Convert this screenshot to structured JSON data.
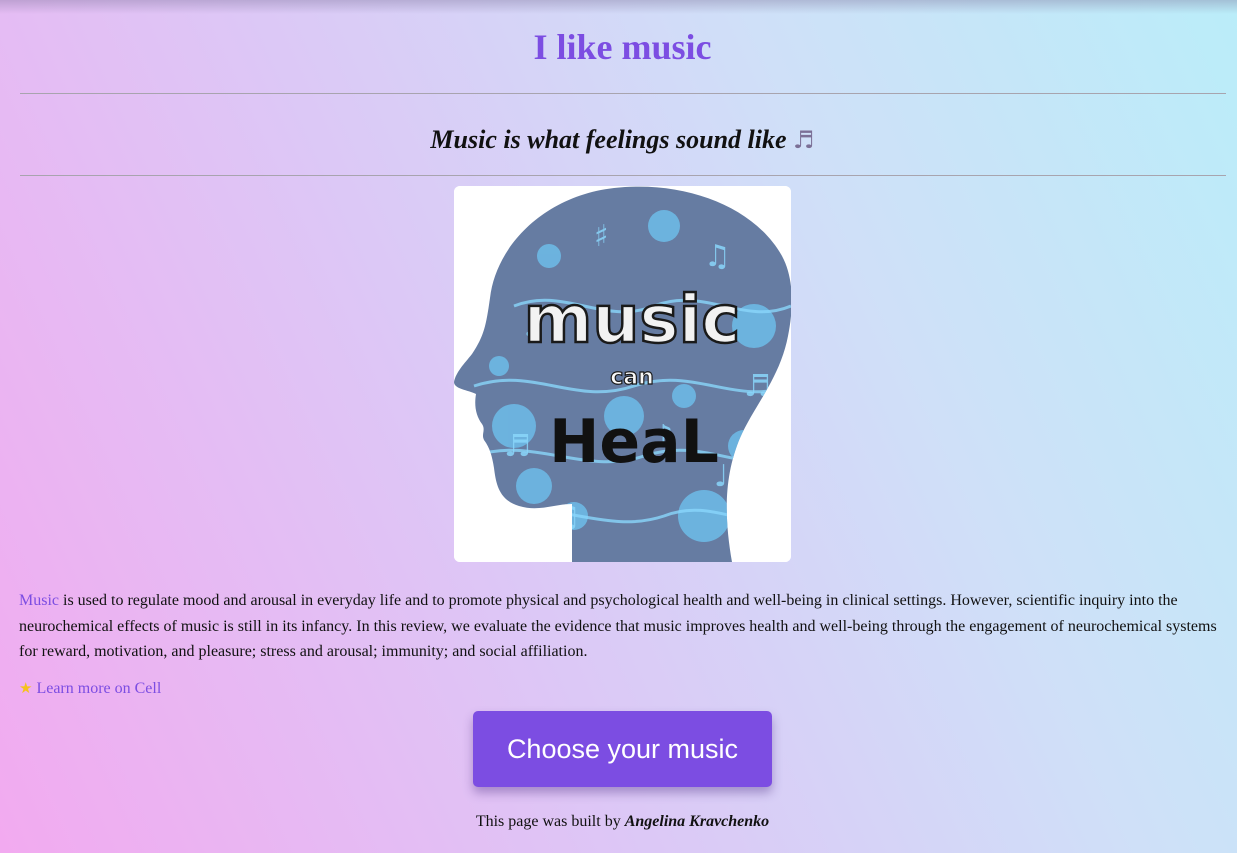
{
  "page": {
    "title": "I like music",
    "subtitle": "Music is what feelings sound like",
    "subtitle_icon": "musical-notes-icon"
  },
  "image": {
    "logo_text_top": "music",
    "logo_text_mid": "can",
    "logo_text_bottom": "HeaL"
  },
  "intro": {
    "link_word": "Music",
    "text": " is used to regulate mood and arousal in everyday life and to promote physical and psychological health and well-being in clinical settings. However, scientific inquiry into the neurochemical effects of music is still in its infancy. In this review, we evaluate the evidence that music improves health and well-being through the engagement of neurochemical systems for reward, motivation, and pleasure; stress and arousal; immunity; and social affiliation."
  },
  "learn_more": {
    "icon": "star-icon",
    "label": "Learn more on Cell"
  },
  "cta": {
    "label": "Choose your music"
  },
  "footer": {
    "text": "This page was built by ",
    "author": "Angelina Kravchenko"
  },
  "colors": {
    "accent": "#7c4de2",
    "gradient_start": "#f2aaf0",
    "gradient_end": "#baedf9",
    "head": "#6a7fa4"
  }
}
